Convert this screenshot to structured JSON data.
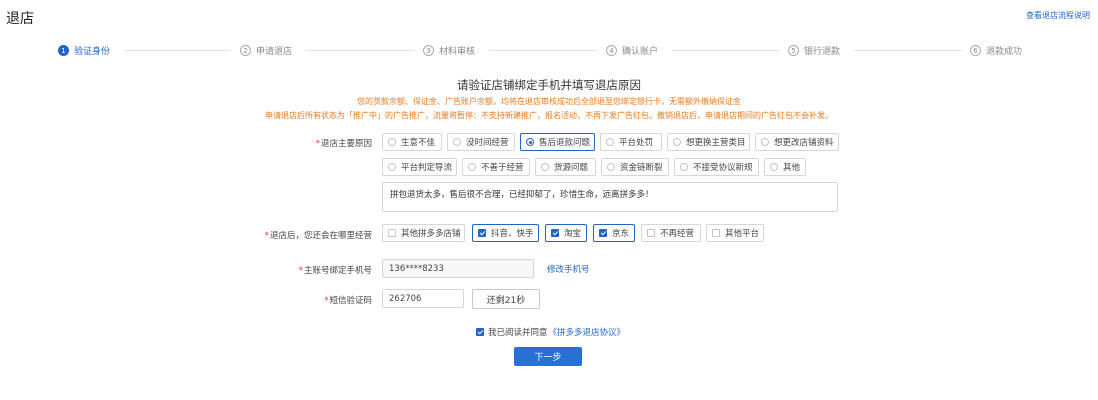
{
  "header": {
    "title": "退店",
    "help_link": "查看退店流程说明"
  },
  "steps": [
    {
      "num": "1",
      "label": "验证身份",
      "active": true
    },
    {
      "num": "2",
      "label": "申请退店",
      "active": false
    },
    {
      "num": "3",
      "label": "材料审核",
      "active": false
    },
    {
      "num": "4",
      "label": "确认账户",
      "active": false
    },
    {
      "num": "5",
      "label": "银行退款",
      "active": false
    },
    {
      "num": "6",
      "label": "退款成功",
      "active": false
    }
  ],
  "form": {
    "title": "请验证店铺绑定手机并填写退店原因",
    "notice_line1": "您的货款余额、保证金、广告账户余额，均将在退店审核成功后全部退至您绑定银行卡，无需额外缴纳保证金",
    "notice_line2": "申请退店后所有状态为「推广中」的广告推广，流量将暂停：不支持新建推广，报名活动，不再下发广告红包，撤销退店后，申请退店期间的广告红包不会补发。",
    "reason": {
      "label": "退店主要原因",
      "options": [
        {
          "label": "生意不佳",
          "selected": false
        },
        {
          "label": "没时间经营",
          "selected": false
        },
        {
          "label": "售后退款问题",
          "selected": true
        },
        {
          "label": "平台处罚",
          "selected": false
        },
        {
          "label": "想更换主营类目",
          "selected": false
        },
        {
          "label": "想更改店铺资料",
          "selected": false
        },
        {
          "label": "平台判定导流",
          "selected": false
        },
        {
          "label": "不善于经营",
          "selected": false
        },
        {
          "label": "货源问题",
          "selected": false
        },
        {
          "label": "资金链断裂",
          "selected": false
        },
        {
          "label": "不接受协议新规",
          "selected": false
        },
        {
          "label": "其他",
          "selected": false
        }
      ],
      "text_value": "拼包退货太多，售后很不合理，已经抑郁了，珍惜生命，远离拼多多！"
    },
    "platforms": {
      "label": "退店后，您还会在哪里经营",
      "options": [
        {
          "label": "其他拼多多店铺",
          "selected": false
        },
        {
          "label": "抖音、快手",
          "selected": true
        },
        {
          "label": "淘宝",
          "selected": true
        },
        {
          "label": "京东",
          "selected": true
        },
        {
          "label": "不再经营",
          "selected": false
        },
        {
          "label": "其他平台",
          "selected": false
        }
      ]
    },
    "phone": {
      "label": "主账号绑定手机号",
      "value": "136****8233",
      "modify_link": "修改手机号"
    },
    "sms": {
      "label": "短信验证码",
      "value": "262706",
      "countdown_label": "还剩21秒"
    },
    "agreement": {
      "prefix": "我已阅读并同意",
      "link": "《拼多多退店协议》",
      "checked": true
    },
    "next_button": "下一步"
  },
  "colors": {
    "accent": "#1f64c8",
    "notice": "#e8791f",
    "required": "#e33333"
  }
}
